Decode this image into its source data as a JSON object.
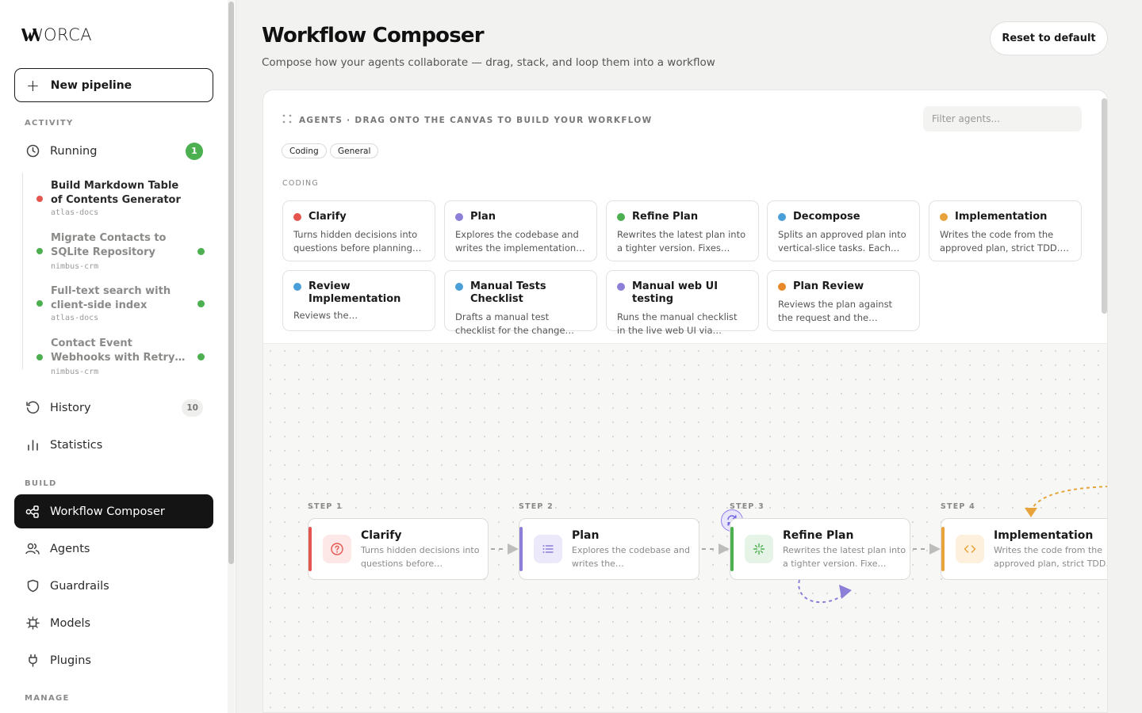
{
  "app": {
    "logo_text": "ORCA"
  },
  "sidebar": {
    "new_pipeline": "New pipeline",
    "sections": {
      "activity": "ACTIVITY",
      "build": "BUILD",
      "manage": "MANAGE"
    },
    "running": {
      "label": "Running",
      "count": "1"
    },
    "runs": [
      {
        "title": "Build Markdown Table of Contents Generator",
        "project": "atlas-docs",
        "status_color": "#e5554f"
      },
      {
        "title": "Migrate Contacts to SQLite Repository",
        "project": "nimbus-crm",
        "status_color": "#4caf50"
      },
      {
        "title": "Full-text search with client-side index",
        "project": "atlas-docs",
        "status_color": "#4caf50"
      },
      {
        "title": "Contact Event Webhooks with Retry…",
        "project": "nimbus-crm",
        "status_color": "#4caf50"
      }
    ],
    "history": {
      "label": "History",
      "count": "10"
    },
    "statistics": "Statistics",
    "build_items": [
      "Workflow Composer",
      "Agents",
      "Guardrails",
      "Models",
      "Plugins"
    ]
  },
  "main": {
    "title": "Workflow Composer",
    "subtitle": "Compose how your agents collaborate — drag, stack, and loop them into a workflow",
    "reset_label": "Reset to default"
  },
  "palette": {
    "heading": "AGENTS · DRAG ONTO THE CANVAS TO BUILD YOUR WORKFLOW",
    "filter_placeholder": "Filter agents...",
    "chips": [
      "Coding",
      "General"
    ],
    "category": "CODING",
    "agents": [
      {
        "name": "Clarify",
        "desc": "Turns hidden decisions into questions before planning…",
        "color": "#e5554f"
      },
      {
        "name": "Plan",
        "desc": "Explores the codebase and writes the implementation…",
        "color": "#8b7fd8"
      },
      {
        "name": "Refine Plan",
        "desc": "Rewrites the latest plan into a tighter version. Fixes…",
        "color": "#4caf50"
      },
      {
        "name": "Decompose",
        "desc": "Splits an approved plan into vertical-slice tasks. Each…",
        "color": "#4a9fd8"
      },
      {
        "name": "Implementation",
        "desc": "Writes the code from the approved plan, strict TDD. I…",
        "color": "#e8a33a"
      },
      {
        "name": "Review Implementation",
        "desc": "Reviews the implementatio…",
        "color": "#4a9fd8"
      },
      {
        "name": "Manual Tests Checklist",
        "desc": "Drafts a manual test checklist for the change…",
        "color": "#4a9fd8"
      },
      {
        "name": "Manual web UI testing",
        "desc": "Runs the manual checklist in the live web UI via…",
        "color": "#8b7fd8"
      },
      {
        "name": "Plan Review",
        "desc": "Reviews the plan against the request and the codebase…",
        "color": "#e88a2a"
      }
    ]
  },
  "workflow": {
    "steps": [
      {
        "label": "STEP 1",
        "name": "Clarify",
        "desc": "Turns hidden decisions into questions before…",
        "color": "#e5554f",
        "icon_bg": "#fde8e7",
        "icon": "question-icon"
      },
      {
        "label": "STEP 2",
        "name": "Plan",
        "desc": "Explores the codebase and writes the…",
        "color": "#8b7fd8",
        "icon_bg": "#ece9fb",
        "icon": "list-icon"
      },
      {
        "label": "STEP 3",
        "name": "Refine Plan",
        "desc": "Rewrites the latest plan into a tighter version. Fixe…",
        "color": "#4caf50",
        "icon_bg": "#e6f4e7",
        "icon": "sparkle-icon"
      },
      {
        "label": "STEP 4",
        "name": "Implementation",
        "desc": "Writes the code from the approved plan, strict TDD…",
        "color": "#e8a33a",
        "icon_bg": "#fdf0dd",
        "icon": "code-icon"
      }
    ]
  }
}
